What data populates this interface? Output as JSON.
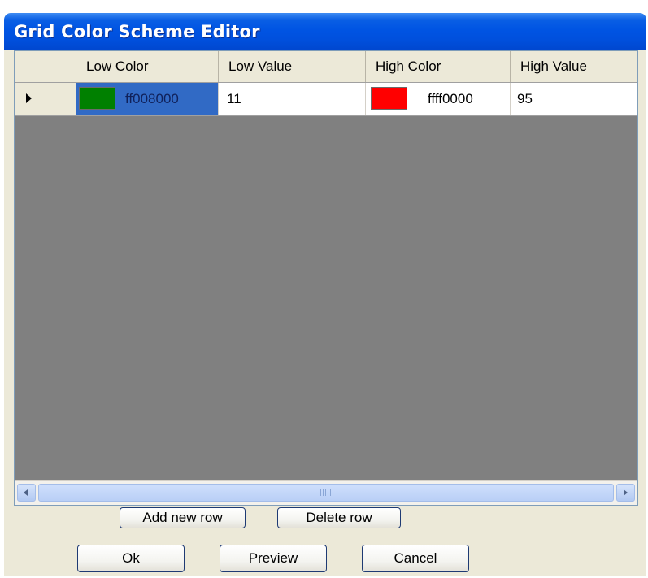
{
  "window": {
    "title": "Grid Color Scheme Editor"
  },
  "grid": {
    "columns": [
      "Low Color",
      "Low Value",
      "High Color",
      "High Value"
    ],
    "rows": [
      {
        "low_color_hex": "ff008000",
        "low_color_swatch": "#008000",
        "low_value": "11",
        "high_color_hex": "ffff0000",
        "high_color_swatch": "#ff0000",
        "high_value": "95"
      }
    ]
  },
  "buttons": {
    "add_row": "Add new row",
    "delete_row": "Delete row",
    "ok": "Ok",
    "preview": "Preview",
    "cancel": "Cancel"
  },
  "icons": {
    "row_pointer": "current-row-arrow-icon",
    "scroll_left": "scroll-left-arrow-icon",
    "scroll_right": "scroll-right-arrow-icon",
    "scroll_grip": "scroll-grip-icon"
  },
  "colors": {
    "titlebar": "#0054e3",
    "selection": "#316ac5",
    "grid_empty": "#808080",
    "dialog_bg": "#ece9d8"
  }
}
